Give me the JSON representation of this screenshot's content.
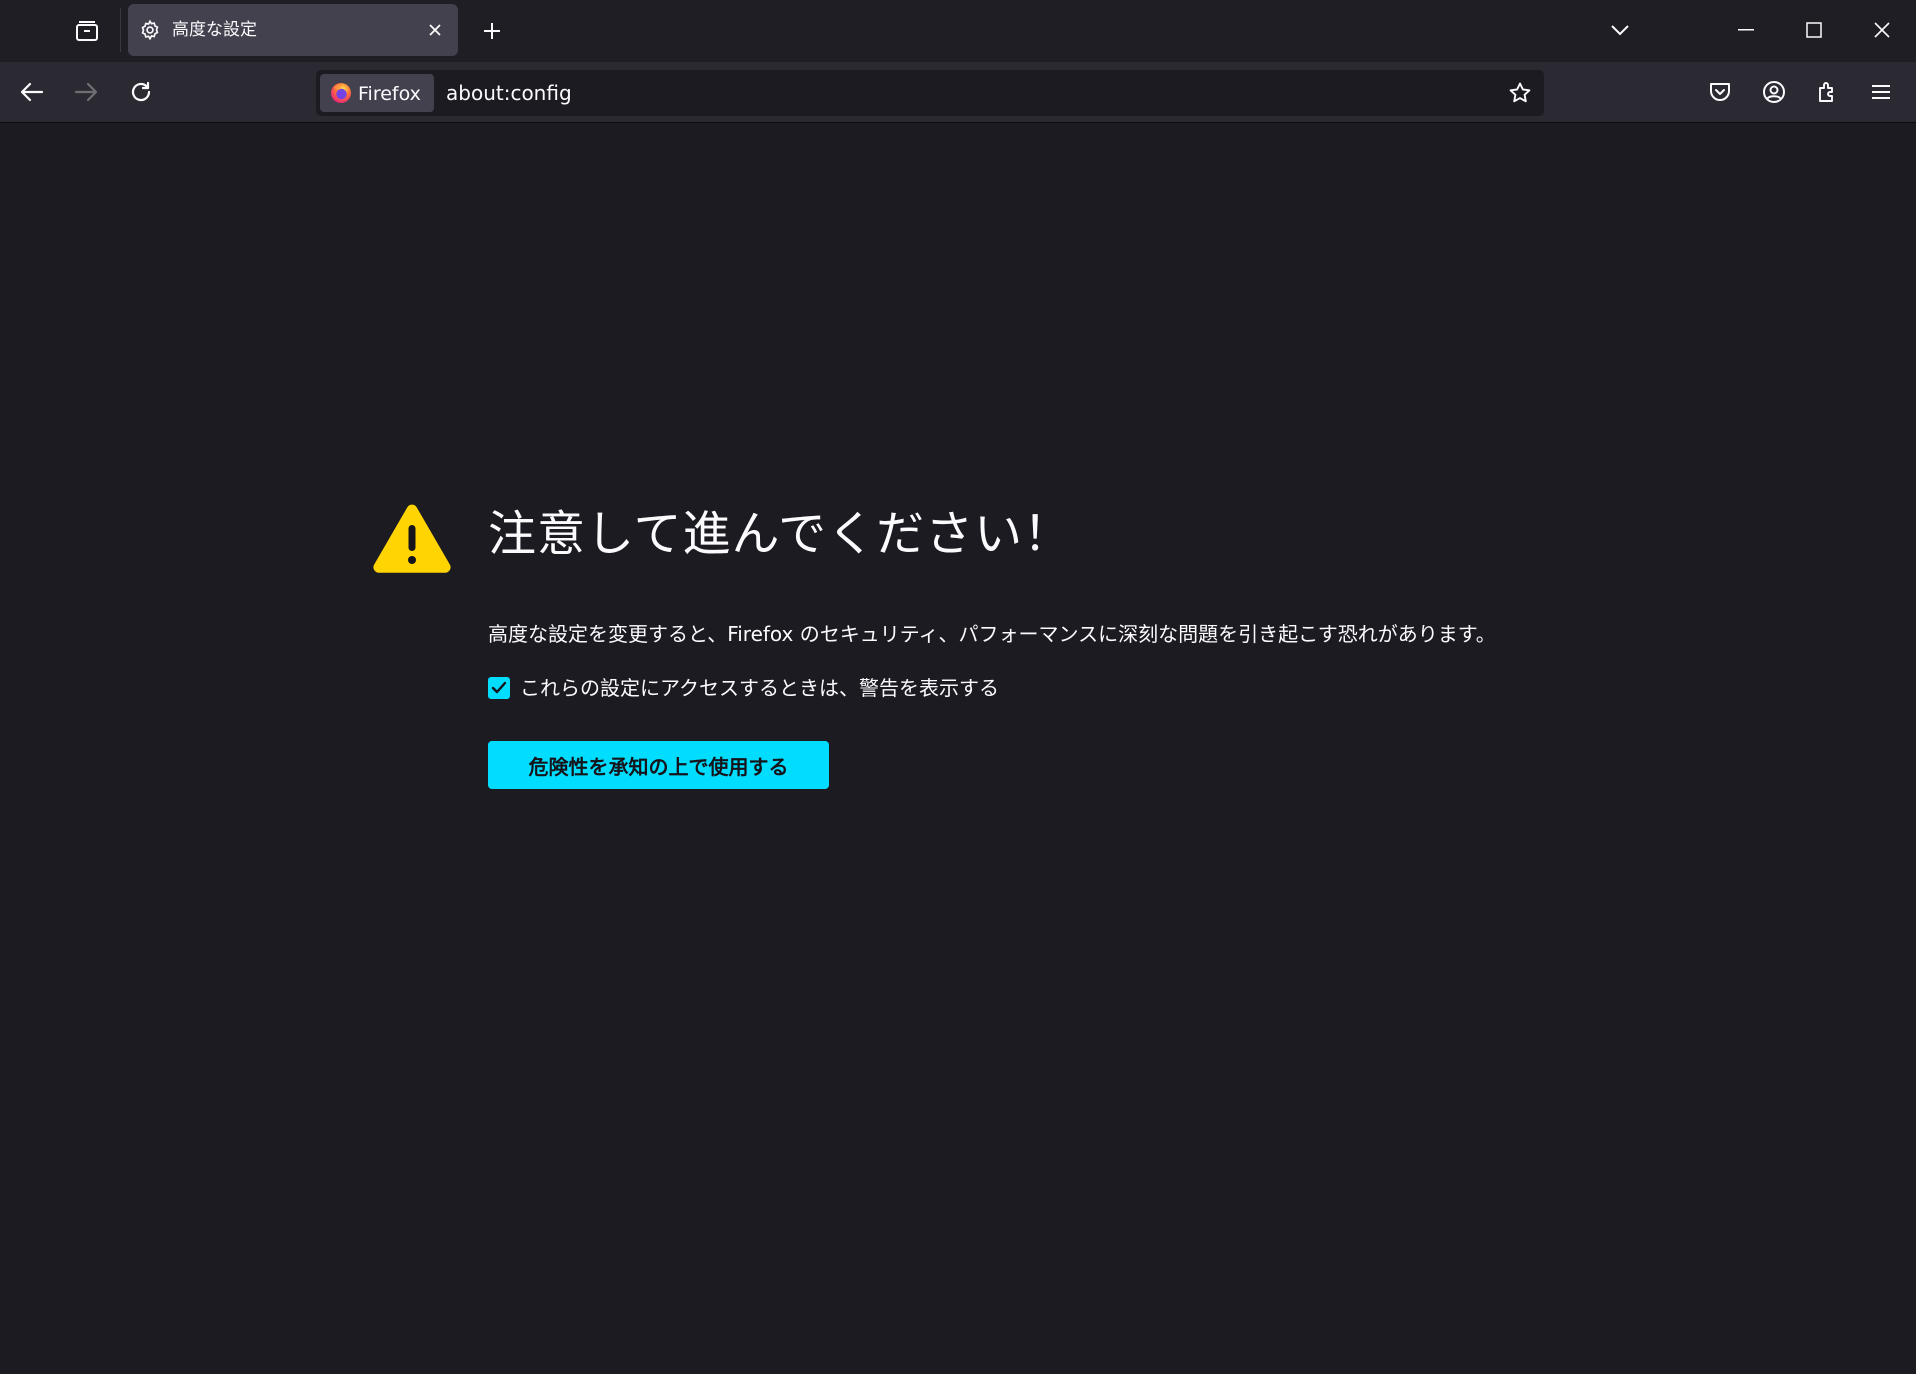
{
  "window": {
    "colors": {
      "background": "#1c1b22",
      "toolbar": "#2b2a33",
      "tab_active": "#42414d",
      "accent": "#00ddff",
      "warning": "#ffd400",
      "text": "#fbfbfe"
    }
  },
  "tabs": [
    {
      "title": "高度な設定",
      "icon": "gear-icon",
      "active": true
    }
  ],
  "titlebar": {
    "buttons": [
      "tab-list-icon",
      "new-tab-icon",
      "chevron-down-icon",
      "minimize-icon",
      "maximize-icon",
      "close-icon"
    ]
  },
  "navbar": {
    "buttons": [
      "back-arrow-icon",
      "forward-arrow-icon",
      "reload-icon"
    ],
    "identity_label": "Firefox",
    "url": "about:config",
    "right_buttons": [
      "pocket-icon",
      "account-icon",
      "extensions-icon",
      "menu-icon"
    ]
  },
  "content": {
    "title": "注意して進んでください！",
    "description": "高度な設定を変更すると、Firefox のセキュリティ、パフォーマンスに深刻な問題を引き起こす恐れがあります。",
    "checkbox": {
      "label": "これらの設定にアクセスするときは、警告を表示する",
      "checked": true
    },
    "accept_button": "危険性を承知の上で使用する"
  }
}
